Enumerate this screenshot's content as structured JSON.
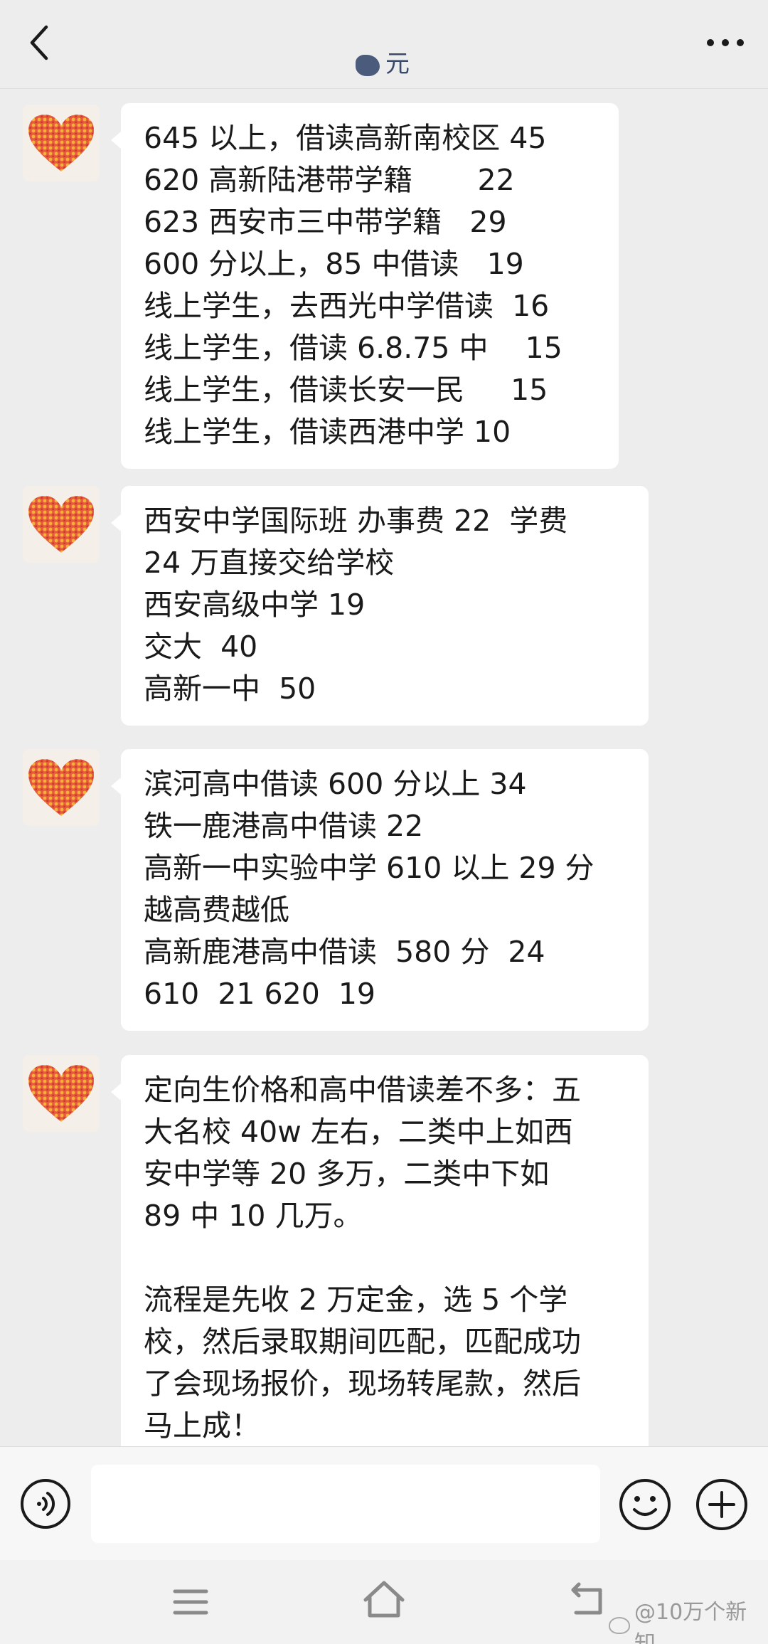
{
  "header": {
    "title": "元",
    "back_icon": "chevron-left-icon",
    "more_icon": "more-horizontal-icon"
  },
  "messages": [
    {
      "avatar": "heart-avatar",
      "lines": [
        "645 以上，借读高新南校区 45",
        "620 高新陆港带学籍       22",
        "623 西安市三中带学籍   29",
        "600 分以上，85 中借读   19",
        "线上学生，去西光中学借读  16",
        "线上学生，借读 6.8.75 中    15",
        "线上学生，借读长安一民     15",
        "线上学生，借读西港中学 10"
      ]
    },
    {
      "avatar": "heart-avatar",
      "lines": [
        "西安中学国际班 办事费 22  学费",
        "24 万直接交给学校",
        "西安高级中学 19",
        "交大  40",
        "高新一中  50"
      ]
    },
    {
      "avatar": "heart-avatar",
      "lines": [
        "滨河高中借读 600 分以上 34",
        "铁一鹿港高中借读 22",
        "高新一中实验中学 610 以上 29 分",
        "越高费越低",
        "高新鹿港高中借读  580 分  24",
        "610  21 620  19"
      ]
    },
    {
      "avatar": "heart-avatar",
      "lines": [
        "定向生价格和高中借读差不多：五",
        "大名校 40w 左右，二类中上如西",
        "安中学等 20 多万，二类中下如",
        "89 中 10 几万。",
        "",
        "流程是先收 2 万定金，选 5 个学",
        "校，然后录取期间匹配，匹配成功",
        "了会现场报价，现场转尾款，然后",
        "马上成！"
      ]
    }
  ],
  "input_bar": {
    "placeholder": "",
    "voice_icon": "voice-icon",
    "emoji_icon": "emoji-icon",
    "plus_icon": "plus-icon"
  },
  "system_nav": {
    "menu_icon": "menu-icon",
    "home_icon": "home-icon",
    "back_icon": "back-icon",
    "watermark": "@10万个新知"
  }
}
